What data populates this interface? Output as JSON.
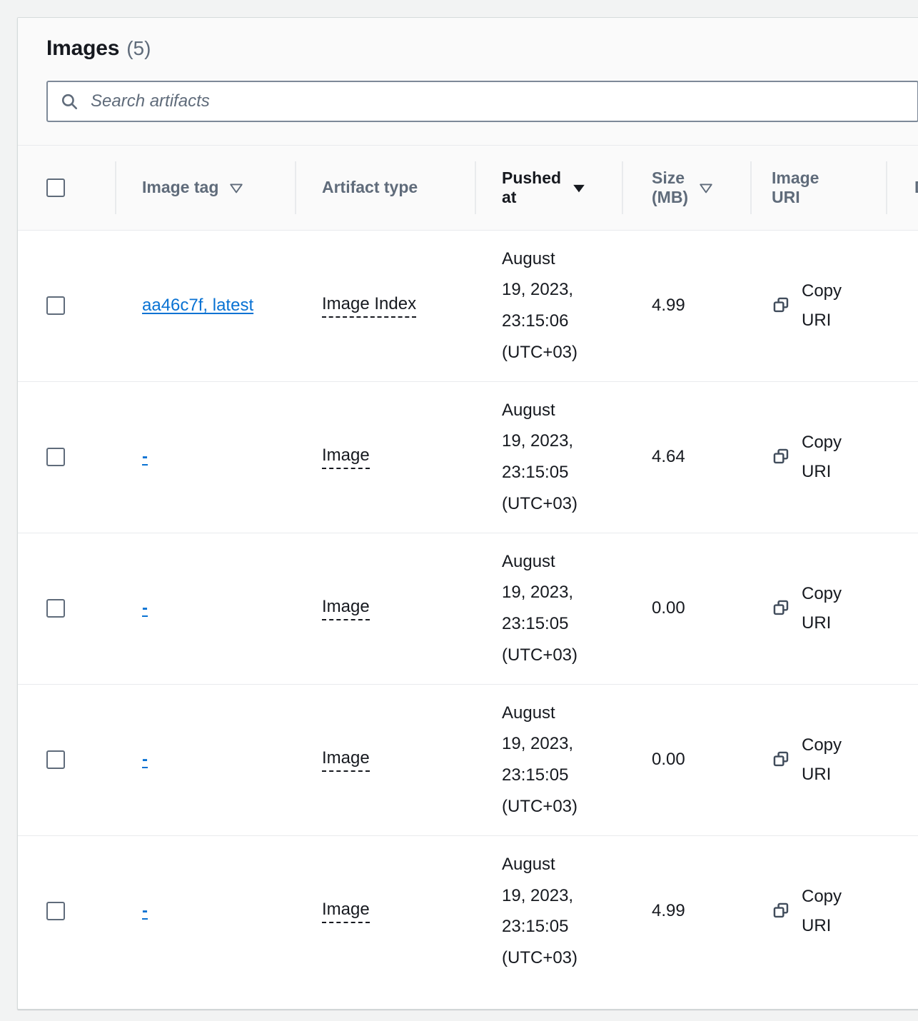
{
  "panel": {
    "title": "Images",
    "count": "(5)"
  },
  "search": {
    "placeholder": "Search artifacts",
    "value": "",
    "icon": "search-icon"
  },
  "table": {
    "columns": [
      {
        "key": "select",
        "label": "",
        "sort": "none"
      },
      {
        "key": "tag",
        "label": "Image tag",
        "sort": "sortable"
      },
      {
        "key": "type",
        "label": "Artifact type",
        "sort": "none"
      },
      {
        "key": "pushed",
        "label": "Pushed at",
        "sort": "active-desc"
      },
      {
        "key": "size",
        "label": "Size (MB)",
        "sort": "sortable"
      },
      {
        "key": "uri",
        "label": "Image URI",
        "sort": "none"
      },
      {
        "key": "next",
        "label": "D",
        "sort": "none"
      }
    ],
    "column_labels": {
      "image_tag": "Image tag",
      "artifact_type": "Artifact type",
      "pushed_at_line1": "Pushed",
      "pushed_at_line2": "at",
      "size_line1": "Size",
      "size_line2": "(MB)",
      "image_uri_line1": "Image",
      "image_uri_line2": "URI",
      "next_partial": "D"
    },
    "copy_uri_label_line1": "Copy",
    "copy_uri_label_line2": "URI",
    "rows": [
      {
        "image_tag": "aa46c7f, latest",
        "artifact_type": "Image Index",
        "pushed_at": "August 19, 2023, 23:15:06 (UTC+03)",
        "pushed_at_lines": [
          "August",
          "19, 2023,",
          "23:15:06",
          "(UTC+03)"
        ],
        "size_mb": "4.99",
        "image_uri": "Copy URI",
        "selected": false
      },
      {
        "image_tag": "-",
        "artifact_type": "Image",
        "pushed_at": "August 19, 2023, 23:15:05 (UTC+03)",
        "pushed_at_lines": [
          "August",
          "19, 2023,",
          "23:15:05",
          "(UTC+03)"
        ],
        "size_mb": "4.64",
        "image_uri": "Copy URI",
        "selected": false
      },
      {
        "image_tag": "-",
        "artifact_type": "Image",
        "pushed_at": "August 19, 2023, 23:15:05 (UTC+03)",
        "pushed_at_lines": [
          "August",
          "19, 2023,",
          "23:15:05",
          "(UTC+03)"
        ],
        "size_mb": "0.00",
        "image_uri": "Copy URI",
        "selected": false
      },
      {
        "image_tag": "-",
        "artifact_type": "Image",
        "pushed_at": "August 19, 2023, 23:15:05 (UTC+03)",
        "pushed_at_lines": [
          "August",
          "19, 2023,",
          "23:15:05",
          "(UTC+03)"
        ],
        "size_mb": "0.00",
        "image_uri": "Copy URI",
        "selected": false
      },
      {
        "image_tag": "-",
        "artifact_type": "Image",
        "pushed_at": "August 19, 2023, 23:15:05 (UTC+03)",
        "pushed_at_lines": [
          "August",
          "19, 2023,",
          "23:15:05",
          "(UTC+03)"
        ],
        "size_mb": "4.99",
        "image_uri": "Copy URI",
        "selected": false
      }
    ]
  },
  "colors": {
    "page_background": "#f2f3f3",
    "card_background": "#ffffff",
    "header_background": "#fafafa",
    "border": "#e9ebed",
    "link": "#0972d3",
    "text_primary": "#16191f",
    "text_secondary": "#5f6b7a",
    "icon": "#414d5c"
  }
}
